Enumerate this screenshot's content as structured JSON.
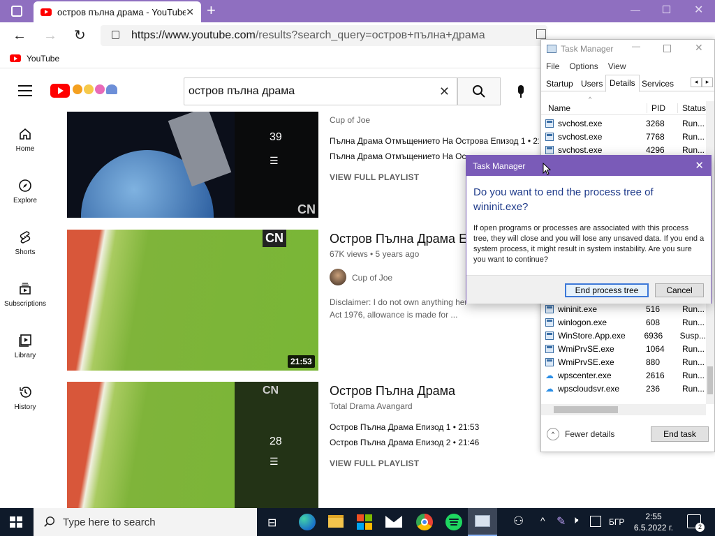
{
  "browser": {
    "tab_title": "остров пълна драма - YouTube",
    "url_host": "https://www.youtube.com",
    "url_path": "/results?search_query=остров+пълна+драма",
    "bookmark": "YouTube"
  },
  "youtube": {
    "search_value": "остров пълна драма",
    "sidebar": [
      {
        "label": "Home"
      },
      {
        "label": "Explore"
      },
      {
        "label": "Shorts"
      },
      {
        "label": "Subscriptions"
      },
      {
        "label": "Library"
      },
      {
        "label": "History"
      }
    ],
    "results": [
      {
        "channel": "Cup of Joe",
        "playlist_count": "39",
        "lines": [
          "Пълна Драма Отмъщението На Острова Епизод 1 • 21:",
          "Пълна Драма Отмъщението На Ос"
        ],
        "view_full": "VIEW FULL PLAYLIST"
      },
      {
        "title": "Остров Пълна Драма Е",
        "meta": "67K views • 5 years ago",
        "channel": "Cup of Joe",
        "duration": "21:53",
        "desc1": "Disclaimer: I do not own anything her",
        "desc2": "Act 1976, allowance is made for ...",
        "logo": "CN"
      },
      {
        "title": "Остров Пълна Драма",
        "channel": "Total Drama Avangard",
        "playlist_count": "28",
        "lines": [
          "Остров Пълна Драма Епизод 1 • 21:53",
          "Остров Пълна Драма Епизод 2 • 21:46"
        ],
        "view_full": "VIEW FULL PLAYLIST",
        "logo": "CN"
      }
    ]
  },
  "task_manager": {
    "title": "Task Manager",
    "menu": [
      "File",
      "Options",
      "View"
    ],
    "tabs": [
      "Startup",
      "Users",
      "Details",
      "Services"
    ],
    "columns": [
      "Name",
      "PID",
      "Status"
    ],
    "rows_top": [
      {
        "name": "svchost.exe",
        "pid": "3268",
        "status": "Run..."
      },
      {
        "name": "svchost.exe",
        "pid": "7768",
        "status": "Run..."
      },
      {
        "name": "svchost.exe",
        "pid": "4296",
        "status": "Run..."
      }
    ],
    "rows_bottom": [
      {
        "name": "wininit.exe",
        "pid": "516",
        "status": "Run..."
      },
      {
        "name": "winlogon.exe",
        "pid": "608",
        "status": "Run..."
      },
      {
        "name": "WinStore.App.exe",
        "pid": "6936",
        "status": "Susp..."
      },
      {
        "name": "WmiPrvSE.exe",
        "pid": "1064",
        "status": "Run..."
      },
      {
        "name": "WmiPrvSE.exe",
        "pid": "880",
        "status": "Run..."
      },
      {
        "name": "wpscenter.exe",
        "pid": "2616",
        "status": "Run..."
      },
      {
        "name": "wpscloudsvr.exe",
        "pid": "236",
        "status": "Run..."
      }
    ],
    "fewer_details": "Fewer details",
    "end_task": "End task"
  },
  "dialog": {
    "title": "Task Manager",
    "heading": "Do you want to end the process tree of wininit.exe?",
    "body": "If open programs or processes are associated with this process tree, they will close and you will lose any unsaved data. If you end a system process, it might result in system instability. Are you sure you want to continue?",
    "confirm": "End process tree",
    "cancel": "Cancel"
  },
  "taskbar": {
    "search_placeholder": "Type here to search",
    "lang": "БГР",
    "time": "2:55",
    "date": "6.5.2022 г.",
    "notifications": "2"
  }
}
